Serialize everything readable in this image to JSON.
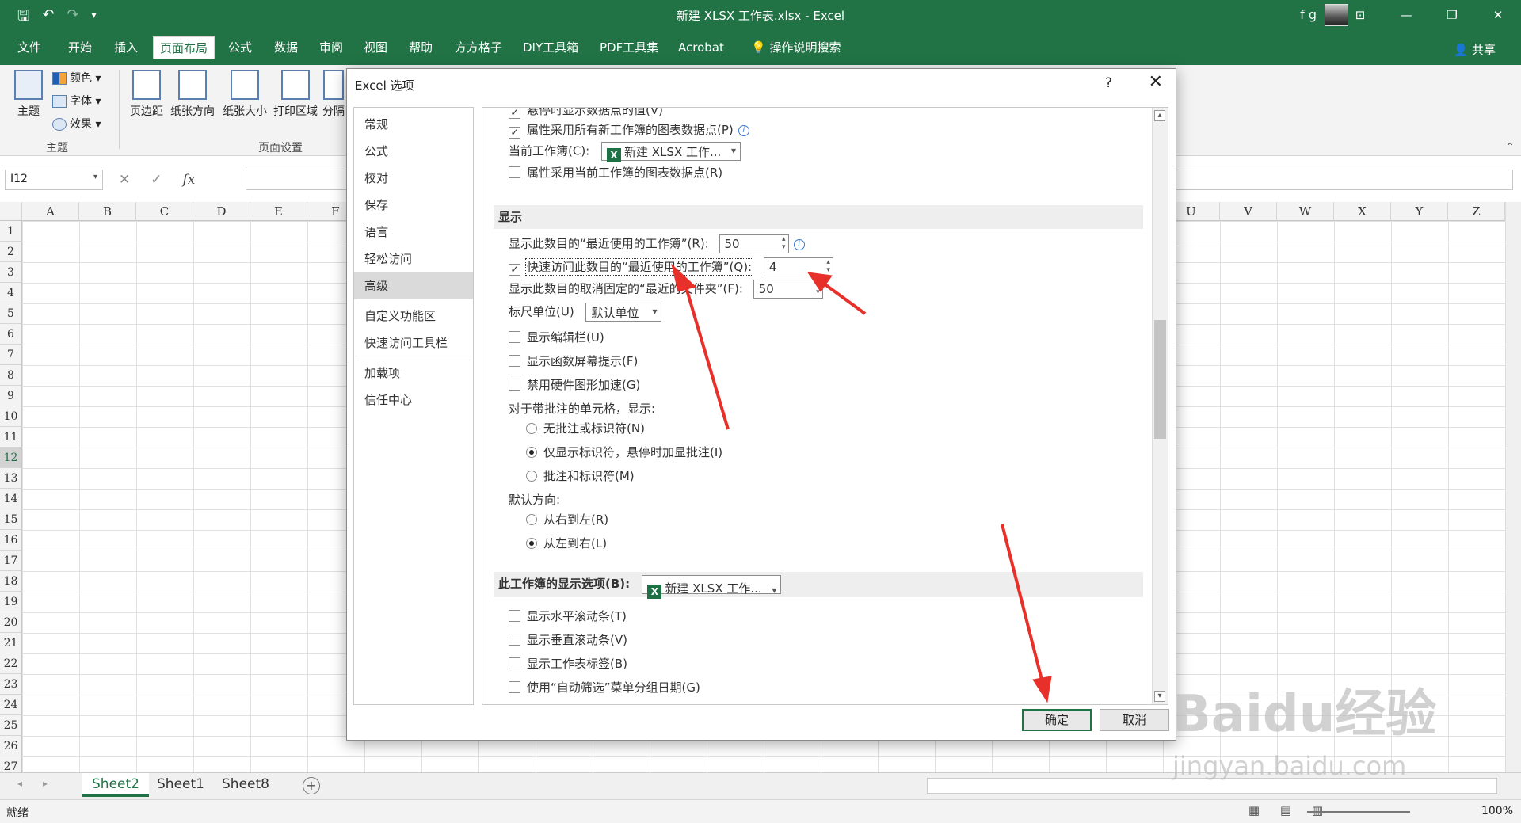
{
  "window": {
    "title": "新建 XLSX 工作表.xlsx  -  Excel",
    "user": "f g",
    "qat_icons": [
      "save-icon",
      "undo-icon",
      "redo-icon",
      "customize-icon"
    ]
  },
  "menu": {
    "tabs": [
      "文件",
      "开始",
      "插入",
      "页面布局",
      "公式",
      "数据",
      "审阅",
      "视图",
      "帮助",
      "方方格子",
      "DIY工具箱",
      "PDF工具集",
      "Acrobat"
    ],
    "active_tab": "页面布局",
    "tell_me": "操作说明搜索",
    "share": "共享"
  },
  "ribbon": {
    "theme_button": "主题",
    "colors": "颜色",
    "fonts": "字体",
    "effects": "效果",
    "group_theme": "主题",
    "margins": "页边距",
    "orientation": "纸张方向",
    "size": "纸张大小",
    "print_area": "打印区域",
    "breaks": "分隔",
    "group_page_setup": "页面设置"
  },
  "formula_bar": {
    "name_box": "I12",
    "fx": "fx",
    "formula": ""
  },
  "grid": {
    "left_columns": [
      "A",
      "B",
      "C",
      "D",
      "E",
      "F"
    ],
    "right_columns": [
      "U",
      "V",
      "W",
      "X",
      "Y",
      "Z"
    ],
    "rows": [
      "1",
      "2",
      "3",
      "4",
      "5",
      "6",
      "7",
      "8",
      "9",
      "10",
      "11",
      "12",
      "13",
      "14",
      "15",
      "16",
      "17",
      "18",
      "19",
      "20",
      "21",
      "22",
      "23",
      "24",
      "25",
      "26",
      "27"
    ],
    "selected_row": "12"
  },
  "sheets": {
    "tabs": [
      "Sheet2",
      "Sheet1",
      "Sheet8"
    ],
    "active": "Sheet2"
  },
  "status": {
    "ready": "就绪",
    "zoom": "100%"
  },
  "dialog": {
    "title": "Excel 选项",
    "help": "?",
    "close": "✕",
    "nav": [
      "常规",
      "公式",
      "校对",
      "保存",
      "语言",
      "轻松访问",
      "高级",
      "自定义功能区",
      "快速访问工具栏",
      "加载项",
      "信任中心"
    ],
    "active_nav": "高级",
    "chart": {
      "cut_item": "悬停时显示数据点的值(V)",
      "props_all": "属性采用所有新工作簿的图表数据点(P)",
      "current_wb_label": "当前工作簿(C):",
      "current_wb_value": "新建 XLSX 工作...",
      "props_current": "属性采用当前工作簿的图表数据点(R)"
    },
    "display": {
      "section": "显示",
      "recent_wb_label": "显示此数目的“最近使用的工作簿”(R):",
      "recent_wb_value": "50",
      "quick_access_label": "快速访问此数目的“最近使用的工作簿”(Q):",
      "quick_access_value": "4",
      "unpinned_label": "显示此数目的取消固定的“最近的文件夹”(F):",
      "unpinned_value": "50",
      "ruler_label": "标尺单位(U)",
      "ruler_value": "默认单位",
      "show_formula_bar": "显示编辑栏(U)",
      "show_screentips": "显示函数屏幕提示(F)",
      "disable_hw_accel": "禁用硬件图形加速(G)",
      "comments_label": "对于带批注的单元格，显示:",
      "no_comments": "无批注或标识符(N)",
      "indicators_only": "仅显示标识符，悬停时加显批注(I)",
      "comments_and_indicators": "批注和标识符(M)",
      "direction_label": "默认方向:",
      "rtl": "从右到左(R)",
      "ltr": "从左到右(L)"
    },
    "workbook": {
      "section": "此工作簿的显示选项(B):",
      "value": "新建 XLSX 工作...",
      "h_scroll": "显示水平滚动条(T)",
      "v_scroll": "显示垂直滚动条(V)",
      "sheet_tabs": "显示工作表标签(B)",
      "autofilter_group": "使用“自动筛选”菜单分组日期(G)"
    },
    "ok": "确定",
    "cancel": "取消"
  },
  "watermark": {
    "main": "Baidu经验",
    "url": "jingyan.baidu.com"
  },
  "colors": {
    "excel_green": "#217346",
    "annotation_red": "#e8302a"
  }
}
